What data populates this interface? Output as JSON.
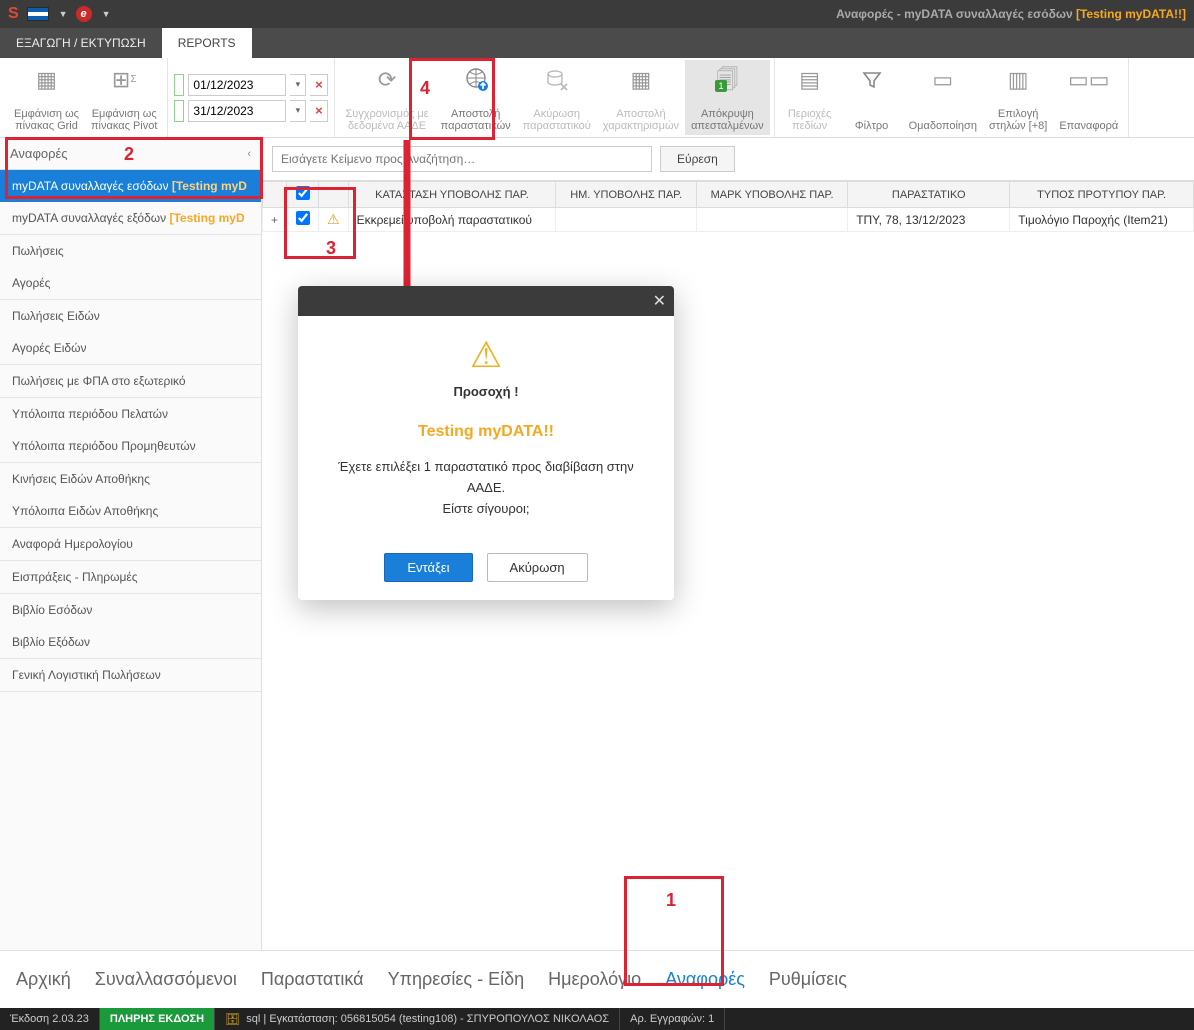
{
  "titlebar": {
    "title_prefix": "Αναφορές - myDATA συναλλαγές εσόδων ",
    "title_tag": "[Testing myDATA!!]"
  },
  "tabs": {
    "export": "ΕΞΑΓΩΓΗ / ΕΚΤΥΠΩΣΗ",
    "reports": "REPORTS"
  },
  "ribbon": {
    "grid_view": "Εμφάνιση ως\nπίνακας Grid",
    "pivot_view": "Εμφάνιση ως\nπίνακας Pivot",
    "date_from": "01/12/2023",
    "date_to": "31/12/2023",
    "sync": "Συγχρονισμός με\nδεδομένα ΑΑΔΕ",
    "send_docs": "Αποστολή\nπαραστατικών",
    "cancel_doc": "Ακύρωση\nπαραστατικού",
    "send_chars": "Αποστολή\nχαρακτηρισμών",
    "hide_sent": "Απόκρυψη\nαπεσταλμένων",
    "fields": "Περιοχές\nπεδίων",
    "filter": "Φίλτρο",
    "group": "Ομαδοποίηση",
    "columns": "Επιλογή\nστηλών [+8]",
    "reset": "Επαναφορά"
  },
  "sidebar": {
    "header": "Αναφορές",
    "items": [
      {
        "label": "myDATA συναλλαγές εσόδων",
        "tag": "[Testing myD"
      },
      {
        "label": "myDATA συναλλαγές εξόδων",
        "tag": "[Testing myD"
      },
      {
        "label": "Πωλήσεις"
      },
      {
        "label": "Αγορές"
      },
      {
        "label": "Πωλήσεις Ειδών"
      },
      {
        "label": "Αγορές Ειδών"
      },
      {
        "label": "Πωλήσεις με ΦΠΑ στο εξωτερικό"
      },
      {
        "label": "Υπόλοιπα περιόδου Πελατών"
      },
      {
        "label": "Υπόλοιπα περιόδου Προμηθευτών"
      },
      {
        "label": "Κινήσεις Ειδών Αποθήκης"
      },
      {
        "label": "Υπόλοιπα Ειδών Αποθήκης"
      },
      {
        "label": "Αναφορά Ημερολογίου"
      },
      {
        "label": "Εισπράξεις - Πληρωμές"
      },
      {
        "label": "Βιβλίο Εσόδων"
      },
      {
        "label": "Βιβλίο Εξόδων"
      },
      {
        "label": "Γενική Λογιστική Πωλήσεων"
      }
    ]
  },
  "search": {
    "placeholder": "Εισάγετε Κείμενο προς Αναζήτηση…",
    "button": "Εύρεση"
  },
  "grid": {
    "columns": {
      "status": "ΚΑΤΑΣΤΑΣΗ ΥΠΟΒΟΛΗΣ ΠΑΡ.",
      "sub_date": "ΗΜ. ΥΠΟΒΟΛΗΣ ΠΑΡ.",
      "mark": "ΜΑΡΚ ΥΠΟΒΟΛΗΣ ΠΑΡ.",
      "doc": "ΠΑΡΑΣΤΑΤΙΚΟ",
      "template": "ΤΥΠΟΣ ΠΡΟΤΥΠΟΥ ΠΑΡ."
    },
    "rows": [
      {
        "status": "Εκκρεμεί υποβολή παραστατικού",
        "sub_date": "",
        "mark": "",
        "doc": "ΤΠΥ, 78, 13/12/2023",
        "template": "Τιμολόγιο Παροχής (Item21)"
      }
    ]
  },
  "bottomnav": {
    "home": "Αρχική",
    "contacts": "Συναλλασσόμενοι",
    "docs": "Παραστατικά",
    "services": "Υπηρεσίες - Είδη",
    "calendar": "Ημερολόγιο",
    "reports": "Αναφορές",
    "settings": "Ρυθμίσεις"
  },
  "statusbar": {
    "version": "Έκδοση 2.03.23",
    "edition": "ΠΛΗΡΗΣ ΕΚΔΟΣΗ",
    "db": "sql | Εγκατάσταση: 056815054 (testing108) - ΣΠΥΡΟΠΟΥΛΟΣ ΝΙΚΟΛΑΟΣ",
    "records": "Αρ. Εγγραφών: 1"
  },
  "modal": {
    "title": "Προσοχή !",
    "tagline": "Testing myDATA!!",
    "message": "Έχετε επιλέξει 1 παραστατικό προς διαβίβαση στην ΑΑΔΕ.\nΕίστε σίγουροι;",
    "ok": "Εντάξει",
    "cancel": "Ακύρωση"
  },
  "annotations": {
    "n1": "1",
    "n2": "2",
    "n3": "3",
    "n4": "4"
  }
}
